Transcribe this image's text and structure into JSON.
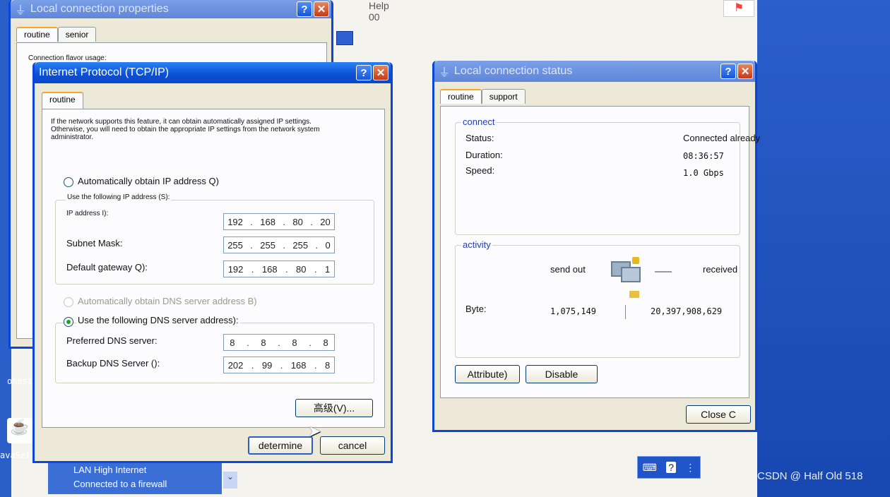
{
  "background": {
    "menu_help": "Help 00",
    "desktop_labels": [
      "onest",
      "avaSetu"
    ],
    "taskbar_item_line1": "LAN High Internet",
    "taskbar_item_line2": "Connected to a firewall"
  },
  "props_window": {
    "title": "Local connection properties",
    "tabs": [
      "routine",
      "senior"
    ],
    "connection_label": "Connection flavor usage:"
  },
  "tcpip_window": {
    "title": "Internet Protocol (TCP/IP)",
    "tab": "routine",
    "description": "If the network supports this feature, it can obtain automatically assigned IP settings. Otherwise, you will need to obtain the appropriate IP settings from the network system administrator.",
    "auto_ip_label": "Automatically obtain IP address Q)",
    "use_ip_label": "Use the following IP address (S):",
    "ip_label": "IP address I):",
    "ip_value": [
      "192",
      "168",
      "80",
      "20"
    ],
    "mask_label": "Subnet Mask:",
    "mask_value": [
      "255",
      "255",
      "255",
      "0"
    ],
    "gateway_label": "Default gateway Q):",
    "gateway_value": [
      "192",
      "168",
      "80",
      "1"
    ],
    "auto_dns_label": "Automatically obtain DNS server address B)",
    "use_dns_label": "Use the following DNS server address):",
    "pref_dns_label": "Preferred DNS server:",
    "pref_dns_value": [
      "8",
      "8",
      "8",
      "8"
    ],
    "backup_dns_label": "Backup DNS Server ():",
    "backup_dns_value": [
      "202",
      "99",
      "168",
      "8"
    ],
    "advanced_button": "高级(V)...",
    "ok_button": "determine",
    "cancel_button": "cancel"
  },
  "status_window": {
    "title": "Local connection status",
    "tabs": [
      "routine",
      "support"
    ],
    "connect_group": "connect",
    "status_label": "Status:",
    "status_value": "Connected already",
    "duration_label": "Duration:",
    "duration_value": "08:36:57",
    "speed_label": "Speed:",
    "speed_value": "1.0 Gbps",
    "activity_group": "activity",
    "send_label": "send out",
    "received_label": "received",
    "bytes_label": "Byte:",
    "bytes_sent": "1,075,149",
    "bytes_received": "20,397,908,629",
    "attribute_button": "Attribute)",
    "disable_button": "Disable",
    "close_button": "Close C"
  },
  "watermark": "CSDN @ Half Old 518",
  "colors": {
    "title_active": "#0a4fd6",
    "group_title": "#1f3fb8",
    "desktop": "#1c4fb8"
  }
}
